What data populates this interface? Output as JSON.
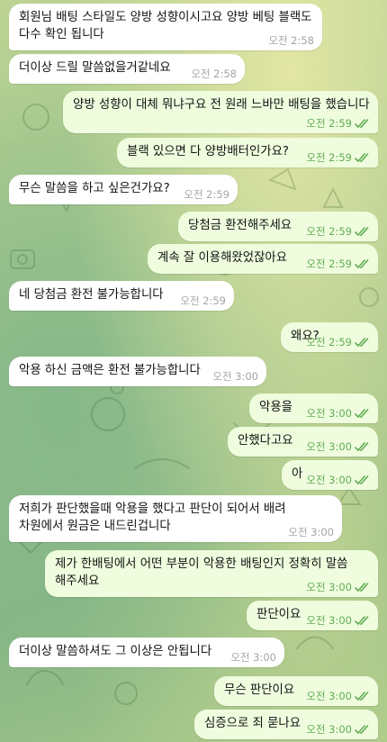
{
  "messages": [
    {
      "dir": "in",
      "text": "회원님 배팅 스타일도 양방 성향이시고요 양방 베팅 블랙도\n다수 확인 됩니다",
      "time": "오전 2:58"
    },
    {
      "dir": "in",
      "text": "더이상 드릴 말씀없을거같네요",
      "time": "오전 2:58"
    },
    {
      "dir": "out",
      "text": "양방 성향이 대체 뭐냐구요 전 원래 느바만 배팅을 했습니다",
      "time": "오전 2:59",
      "read": true
    },
    {
      "dir": "out",
      "text": "블랙 있으면 다 양방배터인가요?",
      "time": "오전 2:59",
      "read": true
    },
    {
      "dir": "in",
      "text": "무슨 말씀을 하고 싶은건가요?",
      "time": "오전 2:59"
    },
    {
      "dir": "out",
      "text": "당첨금 환전해주세요",
      "time": "오전 2:59",
      "read": true
    },
    {
      "dir": "out",
      "text": "계속 잘 이용해왔었잖아요",
      "time": "오전 2:59",
      "read": true
    },
    {
      "dir": "in",
      "text": "네 당첨금 환전 불가능합니다",
      "time": "오전 2:59"
    },
    {
      "dir": "out",
      "text": "왜요?",
      "time": "오전 2:59",
      "read": true
    },
    {
      "dir": "in",
      "text": "악용 하신 금액은 환전 불가능합니다",
      "time": "오전 3:00"
    },
    {
      "dir": "out",
      "text": "악용을",
      "time": "오전 3:00",
      "read": true
    },
    {
      "dir": "out",
      "text": "안했다고요",
      "time": "오전 3:00",
      "read": true
    },
    {
      "dir": "out",
      "text": "아",
      "time": "오전 3:00",
      "read": true
    },
    {
      "dir": "in",
      "text": "저희가 판단했을때 악용을 했다고 판단이 되어서 배려\n차원에서 원금은 내드린겁니다",
      "time": "오전 3:00"
    },
    {
      "dir": "out",
      "text": "제가 한배팅에서 어떤 부분이 악용한 배팅인지 정확히 말씀\n해주세요",
      "time": "오전 3:00",
      "read": true
    },
    {
      "dir": "out",
      "text": "판단이요",
      "time": "오전 3:00",
      "read": true
    },
    {
      "dir": "in",
      "text": "더이상 말씀하셔도 그 이상은 안됩니다",
      "time": "오전 3:00"
    },
    {
      "dir": "out",
      "text": "무슨 판단이요",
      "time": "오전 3:00",
      "read": true
    },
    {
      "dir": "out",
      "text": "심증으로 죄 묻나요",
      "time": "오전 3:00",
      "read": true
    }
  ]
}
